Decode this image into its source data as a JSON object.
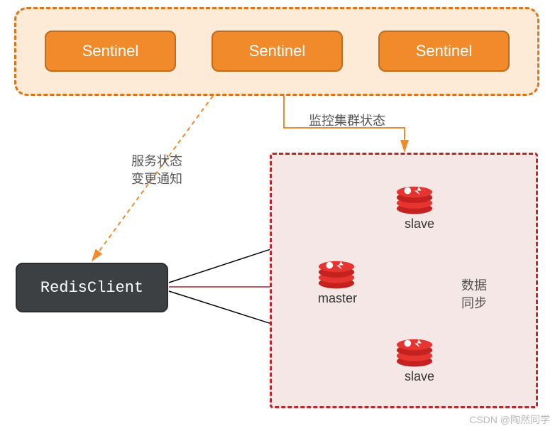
{
  "sentinels": {
    "items": [
      {
        "label": "Sentinel"
      },
      {
        "label": "Sentinel"
      },
      {
        "label": "Sentinel"
      }
    ]
  },
  "client": {
    "label": "RedisClient"
  },
  "cluster": {
    "master": {
      "label": "master"
    },
    "slaves": [
      {
        "label": "slave"
      },
      {
        "label": "slave"
      }
    ]
  },
  "annotations": {
    "monitor": "监控集群状态",
    "notify_line1": "服务状态",
    "notify_line2": "变更通知",
    "sync_line1": "数据",
    "sync_line2": "同步"
  },
  "watermark": "CSDN @陶然同学",
  "colors": {
    "sentinel_fill": "#f08a2a",
    "sentinel_border": "#c16b1b",
    "sentinel_group_bg": "#fdebd8",
    "sentinel_group_border": "#d9751a",
    "cluster_bg": "#f6e7e7",
    "cluster_border": "#b92b2b",
    "client_bg": "#3d4042",
    "redis_icon": "#c5221f"
  }
}
